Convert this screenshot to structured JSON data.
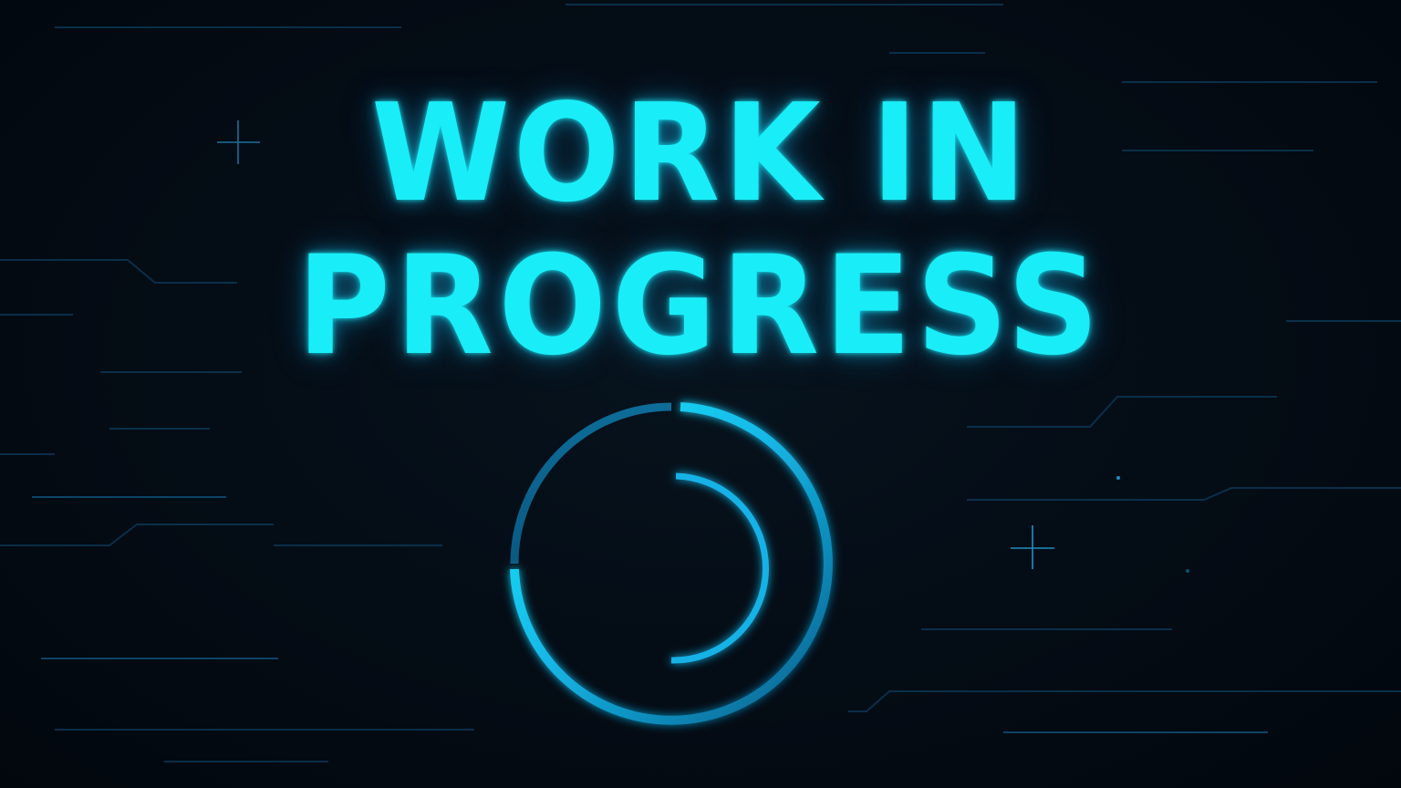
{
  "headline": {
    "line1": "WORK IN",
    "line2": "PROGRESS"
  },
  "colors": {
    "background": "#030a12",
    "accent": "#19eef8",
    "ring_dark": "#0a6fa0",
    "circuit_lines": "#0b3350"
  },
  "icons": [
    "plus-sparkle-icon",
    "loading-spinner-icon"
  ]
}
